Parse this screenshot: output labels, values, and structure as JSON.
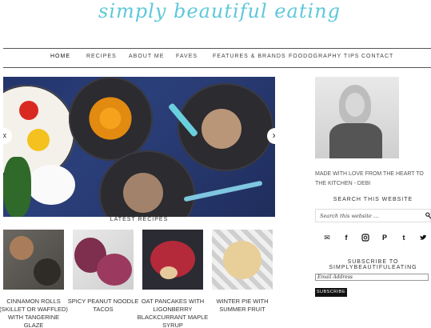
{
  "site": {
    "logo_text": "simply beautiful eating"
  },
  "nav": {
    "items": [
      {
        "label": "HOME"
      },
      {
        "label": "RECIPES"
      },
      {
        "label": "ABOUT ME"
      },
      {
        "label": "FAVES"
      },
      {
        "label": "FEATURES & BRANDS"
      },
      {
        "label": "FOODOGRAPHY TIPS"
      },
      {
        "label": "CONTACT"
      }
    ],
    "active": "HOME"
  },
  "hero": {
    "prev_arrow": "«",
    "next_arrow": "»"
  },
  "latest": {
    "title": "LATEST RECIPES",
    "recipes": [
      {
        "title": "CINNAMON ROLLS (SKILLET OR WAFFLED) WITH TANGERINE GLAZE"
      },
      {
        "title": "SPICY PEANUT NOODLE TACOS"
      },
      {
        "title": "OAT PANCAKES WITH LIGONBERRY BLACKCURRANT MAPLE SYRUP"
      },
      {
        "title": "WINTER PIE WITH SUMMER FRUIT"
      }
    ]
  },
  "sidebar": {
    "tagline": "MADE WITH LOVE FROM THE HEART TO THE KITCHEN - debi",
    "search_title": "SEARCH THIS WEBSITE",
    "search_placeholder": "Search this website …",
    "social_icons": [
      "mail-icon",
      "facebook-icon",
      "instagram-icon",
      "pinterest-icon",
      "tumblr-icon",
      "twitter-icon"
    ],
    "subscribe_title": "SUBSCRIBE TO SIMPLYBEAUTIFULEATING",
    "email_placeholder": "Email Address",
    "subscribe_label": "SUBSCRIBE"
  },
  "colors": {
    "brand": "#5ec8da",
    "nav_border": "#555555",
    "button": "#111111"
  }
}
